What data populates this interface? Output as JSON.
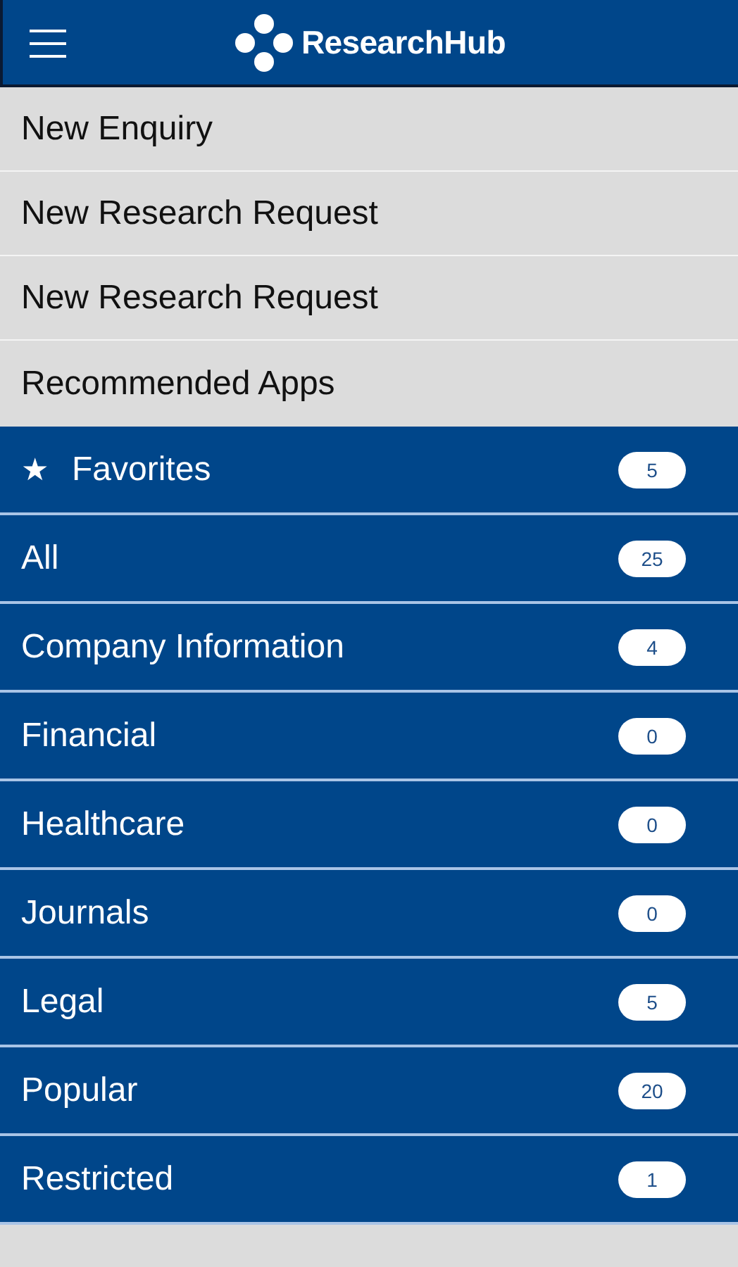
{
  "header": {
    "title": "ResearchHub"
  },
  "actions": [
    {
      "label": "New Enquiry"
    },
    {
      "label": "New Research Request"
    },
    {
      "label": "New Research Request"
    },
    {
      "label": "Recommended Apps"
    }
  ],
  "categories": [
    {
      "icon": "★",
      "label": "Favorites",
      "count": "5"
    },
    {
      "label": "All",
      "count": "25"
    },
    {
      "label": "Company Information",
      "count": "4"
    },
    {
      "label": "Financial",
      "count": "0"
    },
    {
      "label": "Healthcare",
      "count": "0"
    },
    {
      "label": "Journals",
      "count": "0"
    },
    {
      "label": "Legal",
      "count": "5"
    },
    {
      "label": "Popular",
      "count": "20"
    },
    {
      "label": "Restricted",
      "count": "1"
    }
  ]
}
